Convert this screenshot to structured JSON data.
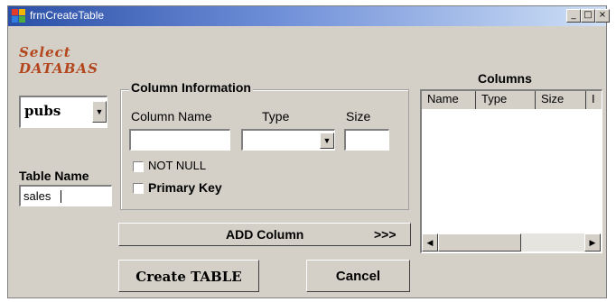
{
  "window": {
    "title": "frmCreateTable",
    "min_label": "_",
    "max_label": "□",
    "close_label": "×"
  },
  "labels": {
    "select_line1": "Select",
    "select_line2": "DATABAS",
    "table_name": "Table Name",
    "column_info": "Column Information",
    "column_name": "Column Name",
    "type": "Type",
    "size": "Size",
    "not_null": "NOT NULL",
    "primary_key": "Primary Key",
    "columns": "Columns"
  },
  "database": {
    "selected": "pubs"
  },
  "table_name": {
    "value": "sales"
  },
  "inputs": {
    "column_name": "",
    "type": "",
    "size": ""
  },
  "grid": {
    "headers": [
      "Name",
      "Type",
      "Size",
      "I"
    ]
  },
  "buttons": {
    "add_column": "ADD Column",
    "add_arrows": ">>>",
    "create_table": "Create TABLE",
    "cancel": "Cancel"
  },
  "colors": {
    "title_start": "#2a4fa6",
    "title_end": "#cfe0f6",
    "face": "#d4d0c8",
    "accent": "#b3461c"
  }
}
